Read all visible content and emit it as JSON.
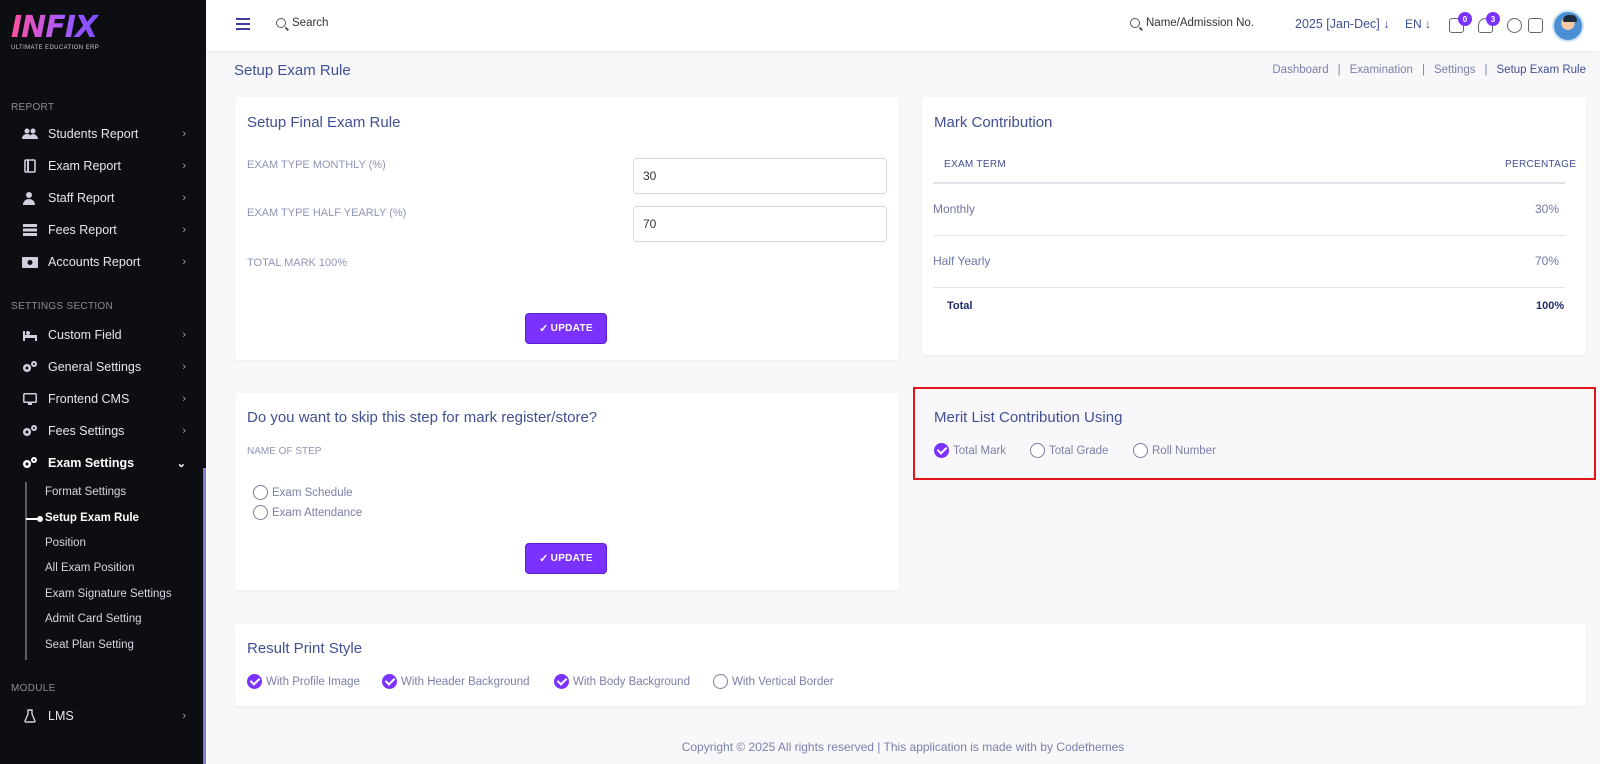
{
  "brand": {
    "logo_text": "INFIX",
    "logo_sub": "ULTIMATE EDUCATION ERP"
  },
  "sidebar": {
    "sections": [
      {
        "title": "REPORT"
      },
      {
        "title": "SETTINGS SECTION"
      },
      {
        "title": "MODULE"
      }
    ],
    "items": [
      {
        "label": "Students Report",
        "icon": "users-icon"
      },
      {
        "label": "Exam Report",
        "icon": "book-icon"
      },
      {
        "label": "Staff Report",
        "icon": "user-tie-icon"
      },
      {
        "label": "Fees Report",
        "icon": "stack-icon"
      },
      {
        "label": "Accounts Report",
        "icon": "money-icon"
      },
      {
        "label": "Custom Field",
        "icon": "bed-icon"
      },
      {
        "label": "General Settings",
        "icon": "cogs-icon"
      },
      {
        "label": "Frontend CMS",
        "icon": "monitor-icon"
      },
      {
        "label": "Fees Settings",
        "icon": "cogs-icon"
      },
      {
        "label": "Exam Settings",
        "icon": "cogs-icon"
      },
      {
        "label": "LMS",
        "icon": "flask-icon"
      }
    ],
    "subitems": [
      {
        "label": "Format Settings"
      },
      {
        "label": "Setup Exam Rule"
      },
      {
        "label": "Position"
      },
      {
        "label": "All Exam Position"
      },
      {
        "label": "Exam Signature Settings"
      },
      {
        "label": "Admit Card Setting"
      },
      {
        "label": "Seat Plan Setting"
      }
    ]
  },
  "header": {
    "search_label": "Search",
    "name_search_label": "Name/Admission No.",
    "session": "2025 [Jan-Dec]",
    "language": "EN",
    "chat_badge": "0",
    "notif_badge": "3"
  },
  "page": {
    "title": "Setup Exam Rule",
    "breadcrumb": [
      "Dashboard",
      "Examination",
      "Settings",
      "Setup Exam Rule"
    ]
  },
  "final_rule": {
    "title": "Setup Final Exam Rule",
    "monthly_label": "EXAM TYPE MONTHLY (%)",
    "monthly_value": "30",
    "half_label": "EXAM TYPE HALF YEARLY (%)",
    "half_value": "70",
    "total_label": "TOTAL MARK 100%",
    "update_label": "UPDATE"
  },
  "mark_contribution": {
    "title": "Mark Contribution",
    "col_term": "EXAM TERM",
    "col_pct": "PERCENTAGE",
    "rows": [
      {
        "term": "Monthly",
        "pct": "30%"
      },
      {
        "term": "Half Yearly",
        "pct": "70%"
      }
    ],
    "total_label": "Total",
    "total_value": "100%"
  },
  "skip_step": {
    "title": "Do you want to skip this step for mark register/store?",
    "name_label": "NAME OF STEP",
    "options": [
      {
        "label": "Exam Schedule",
        "checked": false
      },
      {
        "label": "Exam Attendance",
        "checked": false
      }
    ],
    "update_label": "UPDATE"
  },
  "merit": {
    "title": "Merit List Contribution Using",
    "options": [
      {
        "label": "Total Mark",
        "checked": true
      },
      {
        "label": "Total Grade",
        "checked": false
      },
      {
        "label": "Roll Number",
        "checked": false
      }
    ]
  },
  "result_print": {
    "title": "Result Print Style",
    "options": [
      {
        "label": "With Profile Image",
        "checked": true
      },
      {
        "label": "With Header Background",
        "checked": true
      },
      {
        "label": "With Body Background",
        "checked": true
      },
      {
        "label": "With Vertical Border",
        "checked": false
      }
    ]
  },
  "footer": {
    "text": "Copyright © 2025 All rights reserved | This application is made with by Codethemes"
  },
  "colors": {
    "accent": "#7c32ff",
    "sidebar_bg": "#0d0e12",
    "text": "#415094",
    "highlight": "#e0161a"
  }
}
